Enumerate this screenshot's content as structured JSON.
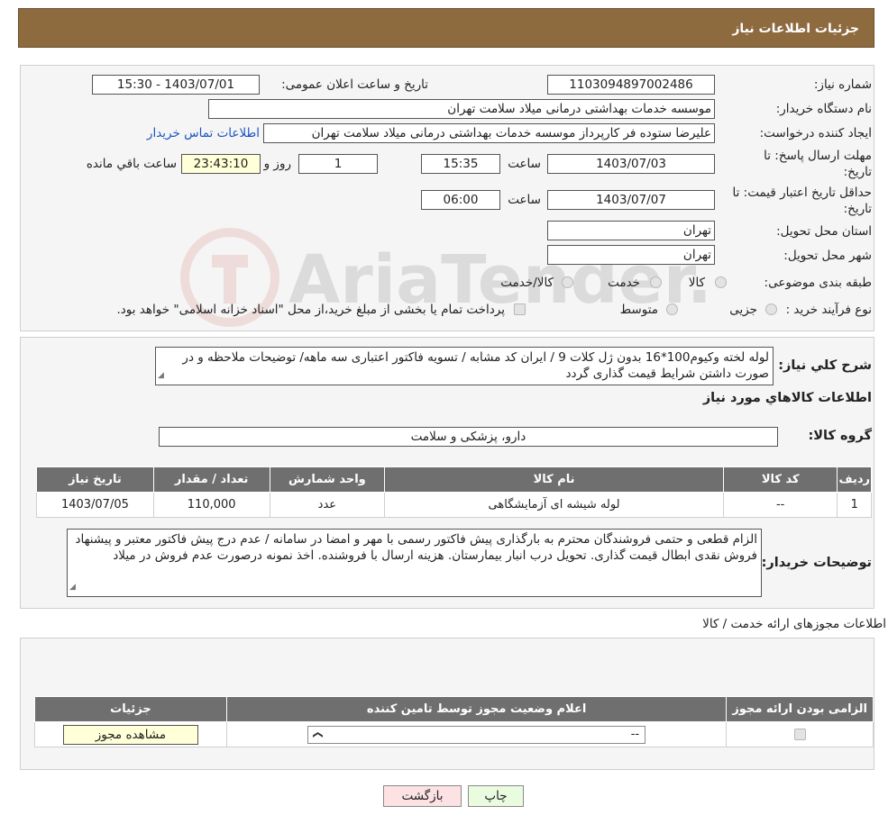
{
  "header": {
    "title": "جزئیات اطلاعات نیاز"
  },
  "watermark": {
    "text": "AriaTender.neT"
  },
  "form": {
    "need_number_label": "شماره نیاز:",
    "need_number_value": "1103094897002486",
    "announce_label": "تاریخ و ساعت اعلان عمومی:",
    "announce_value": "1403/07/01 - 15:30",
    "buyer_org_label": "نام دستگاه خریدار:",
    "buyer_org_value": "موسسه خدمات بهداشتی درمانی میلاد سلامت تهران",
    "creator_label": "ایجاد کننده درخواست:",
    "creator_value": "علیرضا ستوده فر کارپرداز موسسه خدمات بهداشتی درمانی میلاد سلامت تهران",
    "contact_link": "اطلاعات تماس خریدار",
    "deadline_label_1": "مهلت ارسال پاسخ: تا",
    "deadline_label_2": "تاریخ:",
    "deadline_date": "1403/07/03",
    "time_label": "ساعت",
    "deadline_time": "15:35",
    "days_value": "1",
    "days_label": "روز و",
    "remaining_value": "23:43:10",
    "remaining_label": "ساعت باقي مانده",
    "validity_label_1": "حداقل تاریخ اعتبار قیمت: تا",
    "validity_label_2": "تاریخ:",
    "validity_date": "1403/07/07",
    "validity_time": "06:00",
    "province_label": "استان محل تحویل:",
    "province_value": "تهران",
    "city_label": "شهر محل تحویل:",
    "city_value": "تهران",
    "category_label": "طبقه بندی موضوعی:",
    "category_options": [
      "کالا",
      "خدمت",
      "کالا/خدمت"
    ],
    "process_label": "نوع فرآیند خرید :",
    "process_options": [
      "جزیی",
      "متوسط"
    ],
    "process_note": "پرداخت تمام یا بخشی از مبلغ خرید،از محل \"اسناد خزانه اسلامی\" خواهد بود."
  },
  "description": {
    "label": "شرح کلي نياز:",
    "text": "لوله لخته وکیوم100*16 بدون ژل کلات 9 / ایران کد مشابه / تسویه فاکتور اعتباری سه ماهه/ توضیحات ملاحظه و در صورت داشتن شرایط قیمت گذاری گردد",
    "goods_info_title": "اطلاعات کالاهاي مورد نياز",
    "goods_group_label": "گروه کالا:",
    "goods_group_value": "دارو، پزشکی و سلامت"
  },
  "goods_table": {
    "headers": [
      "رديف",
      "کد کالا",
      "نام کالا",
      "واحد شمارش",
      "تعداد / مقدار",
      "تاریخ نیاز"
    ],
    "rows": [
      [
        "1",
        "--",
        "لوله شیشه ای آزمایشگاهی",
        "عدد",
        "110,000",
        "1403/07/05"
      ]
    ]
  },
  "buyer_notes": {
    "label": "توضیحات خریدار:",
    "text": "الزام قطعی و حتمی فروشندگان محترم به بارگذاری پیش فاکتور رسمی با مهر و امضا در سامانه / عدم درج پیش فاکتور معتبر و پیشنهاد فروش نقدی ابطال قیمت گذاری. تحویل درب انبار بیمارستان. هزینه ارسال با فروشنده. اخذ نمونه درصورت عدم فروش در میلاد"
  },
  "licenses": {
    "title": "اطلاعات مجوزهای ارائه خدمت / کالا",
    "headers": [
      "الزامی بودن ارائه مجوز",
      "اعلام وضعیت مجوز توسط تامین کننده",
      "جزئیات"
    ],
    "select_value": "--",
    "view_button": "مشاهده مجوز"
  },
  "footer": {
    "print_button": "چاپ",
    "back_button": "بازگشت"
  }
}
